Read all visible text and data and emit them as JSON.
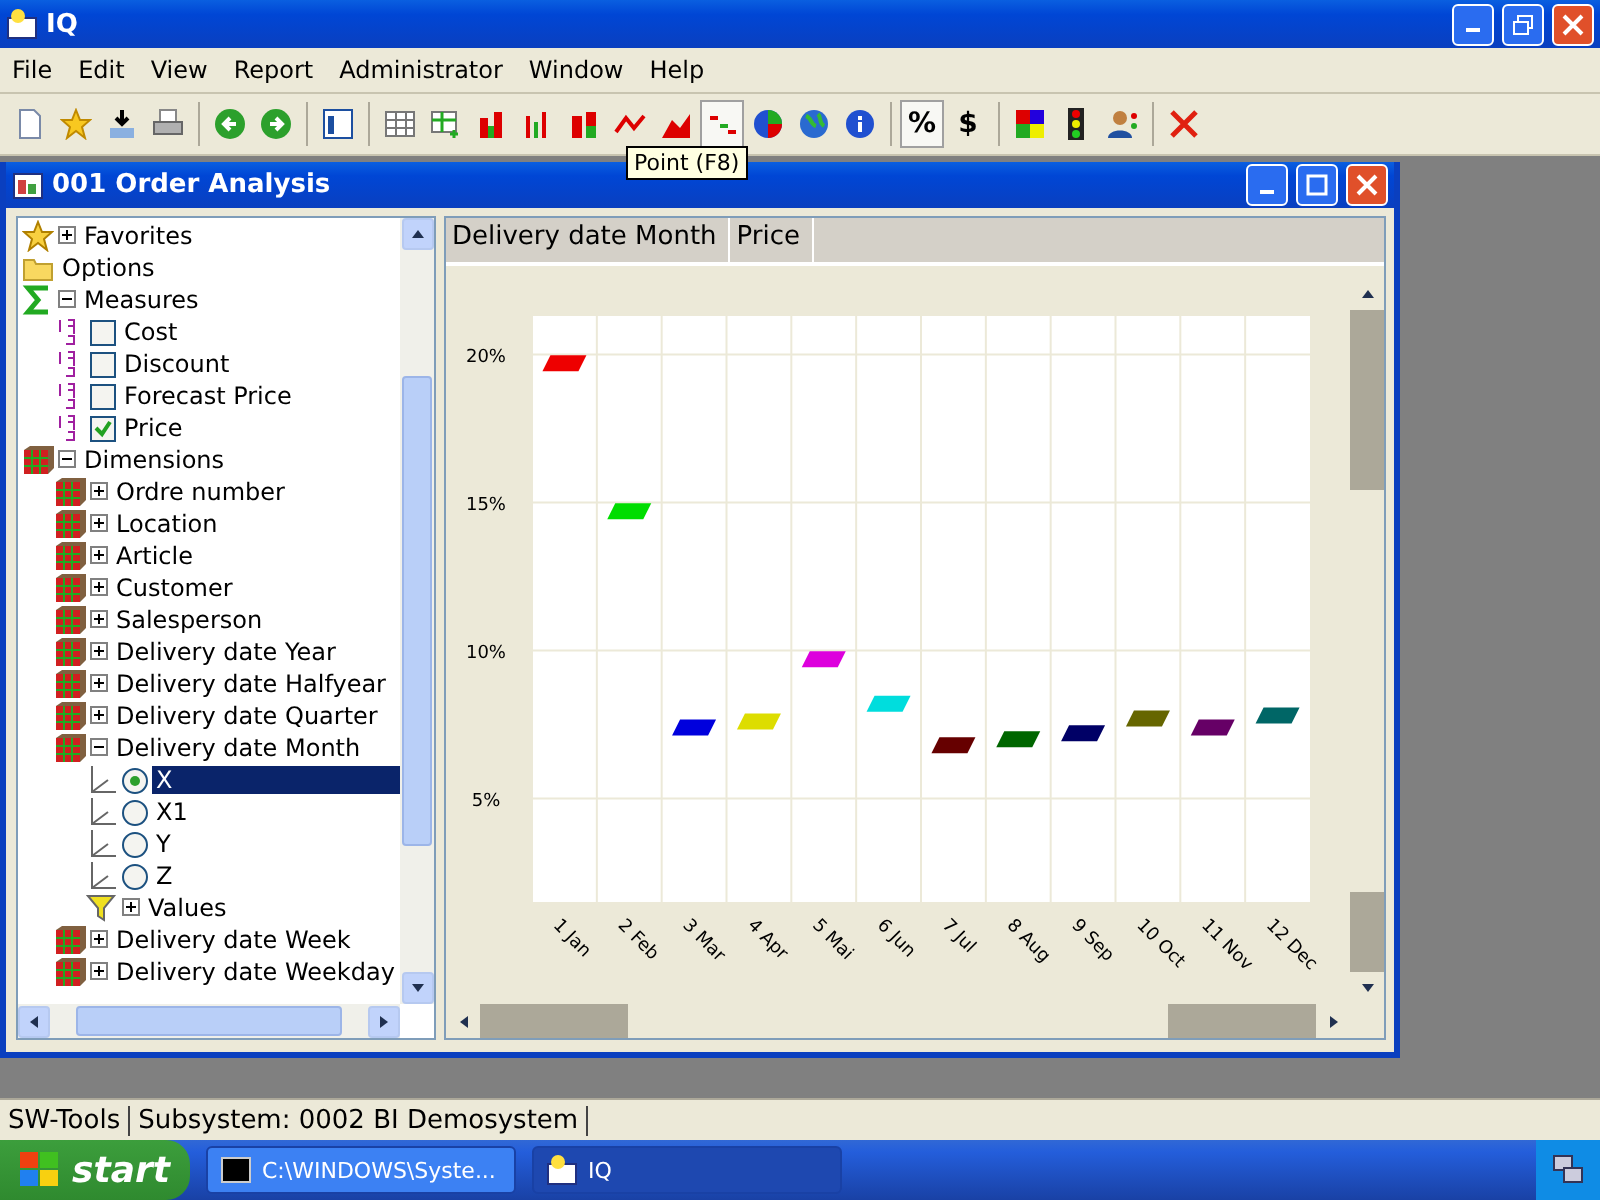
{
  "window": {
    "title": "IQ"
  },
  "menu": [
    "File",
    "Edit",
    "View",
    "Report",
    "Administrator",
    "Window",
    "Help"
  ],
  "toolbar": [
    {
      "kind": "new",
      "pressed": false
    },
    {
      "kind": "star",
      "pressed": false
    },
    {
      "kind": "download",
      "pressed": false
    },
    {
      "kind": "print",
      "pressed": false
    },
    {
      "kind": "sep"
    },
    {
      "kind": "back",
      "pressed": false
    },
    {
      "kind": "forward",
      "pressed": false
    },
    {
      "kind": "sep"
    },
    {
      "kind": "layout",
      "pressed": false
    },
    {
      "kind": "sep"
    },
    {
      "kind": "table",
      "pressed": false
    },
    {
      "kind": "table-add",
      "pressed": false
    },
    {
      "kind": "bars",
      "pressed": false
    },
    {
      "kind": "bars-thin",
      "pressed": false
    },
    {
      "kind": "bars-stack",
      "pressed": false
    },
    {
      "kind": "line",
      "pressed": false
    },
    {
      "kind": "area",
      "pressed": false
    },
    {
      "kind": "point",
      "pressed": true
    },
    {
      "kind": "pie",
      "pressed": false
    },
    {
      "kind": "globe",
      "pressed": false
    },
    {
      "kind": "info",
      "pressed": false
    },
    {
      "kind": "sep"
    },
    {
      "kind": "text",
      "label": "%",
      "pressed": true
    },
    {
      "kind": "text",
      "label": "$",
      "pressed": false
    },
    {
      "kind": "sep"
    },
    {
      "kind": "colors",
      "pressed": false
    },
    {
      "kind": "traffic",
      "pressed": false
    },
    {
      "kind": "user",
      "pressed": false
    },
    {
      "kind": "sep"
    },
    {
      "kind": "close",
      "pressed": false
    }
  ],
  "tooltip": "Point (F8)",
  "child_window": {
    "title": "001  Order Analysis",
    "tree": [
      {
        "kind": "favorites",
        "label": "Favorites",
        "expanded": false
      },
      {
        "kind": "folder",
        "label": "Options"
      },
      {
        "kind": "measures",
        "label": "Measures",
        "expanded": true,
        "children": [
          {
            "kind": "measure",
            "label": "Cost",
            "checked": false
          },
          {
            "kind": "measure",
            "label": "Discount",
            "checked": false
          },
          {
            "kind": "measure",
            "label": "Forecast Price",
            "checked": false
          },
          {
            "kind": "measure",
            "label": "Price",
            "checked": true
          }
        ]
      },
      {
        "kind": "dimension",
        "label": "Dimensions",
        "expanded": true,
        "children": [
          {
            "kind": "dimension",
            "label": "Ordre number",
            "expanded": false
          },
          {
            "kind": "dimension",
            "label": "Location",
            "expanded": false
          },
          {
            "kind": "dimension",
            "label": "Article",
            "expanded": false
          },
          {
            "kind": "dimension",
            "label": "Customer",
            "expanded": false
          },
          {
            "kind": "dimension",
            "label": "Salesperson",
            "expanded": false
          },
          {
            "kind": "dimension",
            "label": "Delivery date Year",
            "expanded": false
          },
          {
            "kind": "dimension",
            "label": "Delivery date Halfyear",
            "expanded": false
          },
          {
            "kind": "dimension",
            "label": "Delivery date Quarter",
            "expanded": false
          },
          {
            "kind": "dimension",
            "label": "Delivery date Month",
            "expanded": true,
            "children": [
              {
                "kind": "axis",
                "label": "X",
                "selected": true
              },
              {
                "kind": "axis",
                "label": "X1",
                "selected": false
              },
              {
                "kind": "axis",
                "label": "Y",
                "selected": false
              },
              {
                "kind": "axis",
                "label": "Z",
                "selected": false
              },
              {
                "kind": "filter",
                "label": "Values",
                "expanded": false
              }
            ]
          },
          {
            "kind": "dimension",
            "label": "Delivery date Week",
            "expanded": false
          },
          {
            "kind": "dimension",
            "label": "Delivery date Weekday",
            "expanded": false
          }
        ]
      }
    ],
    "columns": [
      {
        "label": "Delivery date Month"
      },
      {
        "label": "Price"
      }
    ],
    "chart_data": {
      "type": "scatter",
      "categories": [
        "1 Jan",
        "2 Feb",
        "3 Mar",
        "4 Apr",
        "5 Mai",
        "6 Jun",
        "7 Jul",
        "8 Aug",
        "9 Sep",
        "10 Oct",
        "11 Nov",
        "12 Dec"
      ],
      "series": [
        {
          "color": "#ee0000",
          "values": [
            19.7,
            null,
            null,
            null,
            null,
            null,
            null,
            null,
            null,
            null,
            null,
            null
          ]
        },
        {
          "color": "#00dd00",
          "values": [
            null,
            14.7,
            null,
            null,
            null,
            null,
            null,
            null,
            null,
            null,
            null,
            null
          ]
        },
        {
          "color": "#0000dd",
          "values": [
            null,
            null,
            7.4,
            null,
            null,
            null,
            null,
            null,
            null,
            null,
            null,
            null
          ]
        },
        {
          "color": "#dddd00",
          "values": [
            null,
            null,
            null,
            7.6,
            null,
            null,
            null,
            null,
            null,
            null,
            null,
            null
          ]
        },
        {
          "color": "#dd00dd",
          "values": [
            null,
            null,
            null,
            null,
            9.7,
            null,
            null,
            null,
            null,
            null,
            null,
            null
          ]
        },
        {
          "color": "#00dddd",
          "values": [
            null,
            null,
            null,
            null,
            null,
            8.2,
            null,
            null,
            null,
            null,
            null,
            null
          ]
        },
        {
          "color": "#660000",
          "values": [
            null,
            null,
            null,
            null,
            null,
            null,
            6.8,
            null,
            null,
            null,
            null,
            null
          ]
        },
        {
          "color": "#006600",
          "values": [
            null,
            null,
            null,
            null,
            null,
            null,
            null,
            7.0,
            null,
            null,
            null,
            null
          ]
        },
        {
          "color": "#000066",
          "values": [
            null,
            null,
            null,
            null,
            null,
            null,
            null,
            null,
            7.2,
            null,
            null,
            null
          ]
        },
        {
          "color": "#666600",
          "values": [
            null,
            null,
            null,
            null,
            null,
            null,
            null,
            null,
            null,
            7.7,
            null,
            null
          ]
        },
        {
          "color": "#660066",
          "values": [
            null,
            null,
            null,
            null,
            null,
            null,
            null,
            null,
            null,
            null,
            7.4,
            null
          ]
        },
        {
          "color": "#006666",
          "values": [
            null,
            null,
            null,
            null,
            null,
            null,
            null,
            null,
            null,
            null,
            null,
            7.8
          ]
        }
      ],
      "ylim": [
        1.5,
        21.3
      ],
      "grid": true,
      "yticks": [
        {
          "value": 5,
          "label": "5%"
        },
        {
          "value": 10,
          "label": "10%"
        },
        {
          "value": 15,
          "label": "15%"
        },
        {
          "value": 20,
          "label": "20%"
        }
      ]
    }
  },
  "status_bar": [
    "SW-Tools",
    "Subsystem: 0002 BI Demosystem"
  ],
  "taskbar": {
    "start": "start",
    "tasks": [
      {
        "kind": "console",
        "label": "C:\\WINDOWS\\Syste...",
        "selected": false
      },
      {
        "kind": "app",
        "label": "IQ",
        "selected": true
      }
    ]
  }
}
